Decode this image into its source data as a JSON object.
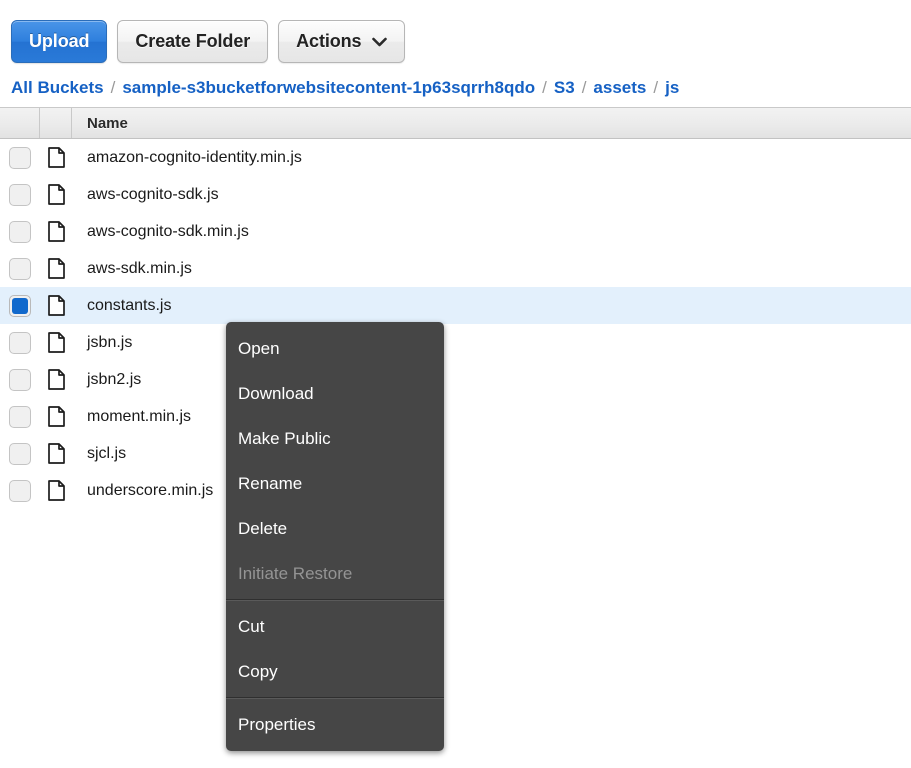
{
  "toolbar": {
    "upload_label": "Upload",
    "create_folder_label": "Create Folder",
    "actions_label": "Actions",
    "actions_caret_icon": "chevron-down-icon"
  },
  "breadcrumb": {
    "separator": "/",
    "items": [
      {
        "label": "All Buckets"
      },
      {
        "label": "sample-s3bucketforwebsitecontent-1p63sqrrh8qdo"
      },
      {
        "label": "S3"
      },
      {
        "label": "assets"
      },
      {
        "label": "js"
      }
    ]
  },
  "table": {
    "columns": [
      {
        "label": ""
      },
      {
        "label": ""
      },
      {
        "label": "Name"
      }
    ],
    "rows": [
      {
        "name": "amazon-cognito-identity.min.js",
        "selected": false,
        "icon": "file-icon"
      },
      {
        "name": "aws-cognito-sdk.js",
        "selected": false,
        "icon": "file-icon"
      },
      {
        "name": "aws-cognito-sdk.min.js",
        "selected": false,
        "icon": "file-icon"
      },
      {
        "name": "aws-sdk.min.js",
        "selected": false,
        "icon": "file-icon"
      },
      {
        "name": "constants.js",
        "selected": true,
        "icon": "file-icon"
      },
      {
        "name": "jsbn.js",
        "selected": false,
        "icon": "file-icon"
      },
      {
        "name": "jsbn2.js",
        "selected": false,
        "icon": "file-icon"
      },
      {
        "name": "moment.min.js",
        "selected": false,
        "icon": "file-icon"
      },
      {
        "name": "sjcl.js",
        "selected": false,
        "icon": "file-icon"
      },
      {
        "name": "underscore.min.js",
        "selected": false,
        "icon": "file-icon"
      }
    ]
  },
  "context_menu": {
    "items": [
      {
        "label": "Open",
        "disabled": false,
        "separator_after": false
      },
      {
        "label": "Download",
        "disabled": false,
        "separator_after": false
      },
      {
        "label": "Make Public",
        "disabled": false,
        "separator_after": false
      },
      {
        "label": "Rename",
        "disabled": false,
        "separator_after": false
      },
      {
        "label": "Delete",
        "disabled": false,
        "separator_after": false
      },
      {
        "label": "Initiate Restore",
        "disabled": true,
        "separator_after": true
      },
      {
        "label": "Cut",
        "disabled": false,
        "separator_after": false
      },
      {
        "label": "Copy",
        "disabled": false,
        "separator_after": true
      },
      {
        "label": "Properties",
        "disabled": false,
        "separator_after": false
      }
    ]
  },
  "colors": {
    "primary_button": "#2e7fdd",
    "link": "#1661c4",
    "selected_row": "#e3f0fc",
    "checkbox_checked": "#1169cc",
    "menu_background": "#464646"
  }
}
